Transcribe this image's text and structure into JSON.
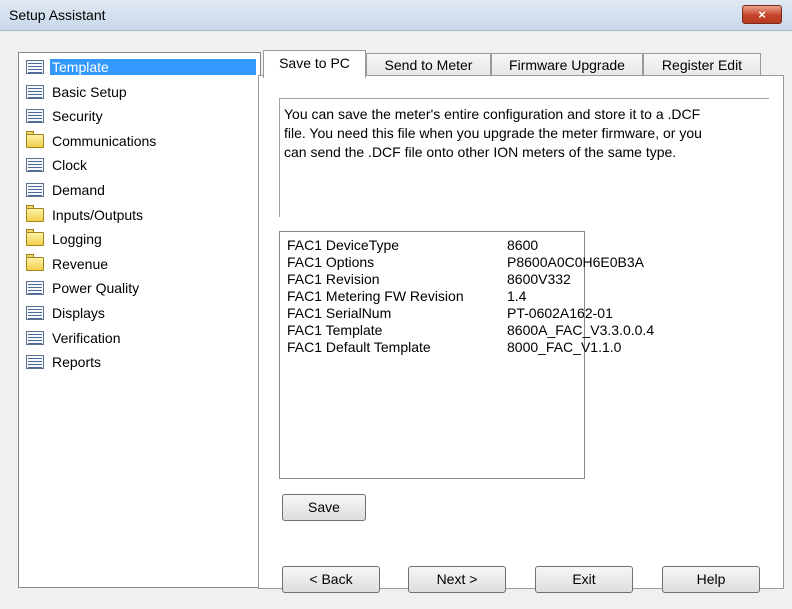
{
  "window": {
    "title": "Setup Assistant",
    "close_glyph": "×"
  },
  "tree": {
    "items": [
      {
        "label": "Template",
        "icon": "form-icon",
        "selected": true
      },
      {
        "label": "Basic Setup",
        "icon": "form-icon"
      },
      {
        "label": "Security",
        "icon": "form-icon"
      },
      {
        "label": "Communications",
        "icon": "folder-icon"
      },
      {
        "label": "Clock",
        "icon": "form-icon"
      },
      {
        "label": "Demand",
        "icon": "form-icon"
      },
      {
        "label": "Inputs/Outputs",
        "icon": "folder-icon"
      },
      {
        "label": "Logging",
        "icon": "folder-icon"
      },
      {
        "label": "Revenue",
        "icon": "folder-icon"
      },
      {
        "label": "Power Quality",
        "icon": "form-icon"
      },
      {
        "label": "Displays",
        "icon": "form-icon"
      },
      {
        "label": "Verification",
        "icon": "form-icon"
      },
      {
        "label": "Reports",
        "icon": "form-icon"
      }
    ]
  },
  "tabs": [
    {
      "label": "Save to PC",
      "active": true
    },
    {
      "label": "Send to Meter"
    },
    {
      "label": "Firmware Upgrade"
    },
    {
      "label": "Register Edit"
    }
  ],
  "save_to_pc": {
    "description_lines": [
      "You can save the meter's entire configuration and store it to a .DCF",
      "file. You need this file when you upgrade the meter firmware, or you",
      "can send the .DCF file onto other ION meters of the same type."
    ],
    "info": [
      {
        "key": "FAC1 DeviceType",
        "value": "8600"
      },
      {
        "key": "FAC1 Options",
        "value": "P8600A0C0H6E0B3A"
      },
      {
        "key": "FAC1 Revision",
        "value": "8600V332"
      },
      {
        "key": "FAC1 Metering FW Revision",
        "value": "1.4"
      },
      {
        "key": "FAC1 SerialNum",
        "value": "PT-0602A162-01"
      },
      {
        "key": "FAC1 Template",
        "value": "8600A_FAC_V3.3.0.0.4"
      },
      {
        "key": "FAC1 Default Template",
        "value": "8000_FAC_V1.1.0"
      }
    ],
    "save_label": "Save"
  },
  "buttons": {
    "back": "< Back",
    "next": "Next >",
    "exit": "Exit",
    "help": "Help"
  },
  "colors": {
    "selection": "#3399ff",
    "close_button": "#c7442b"
  }
}
